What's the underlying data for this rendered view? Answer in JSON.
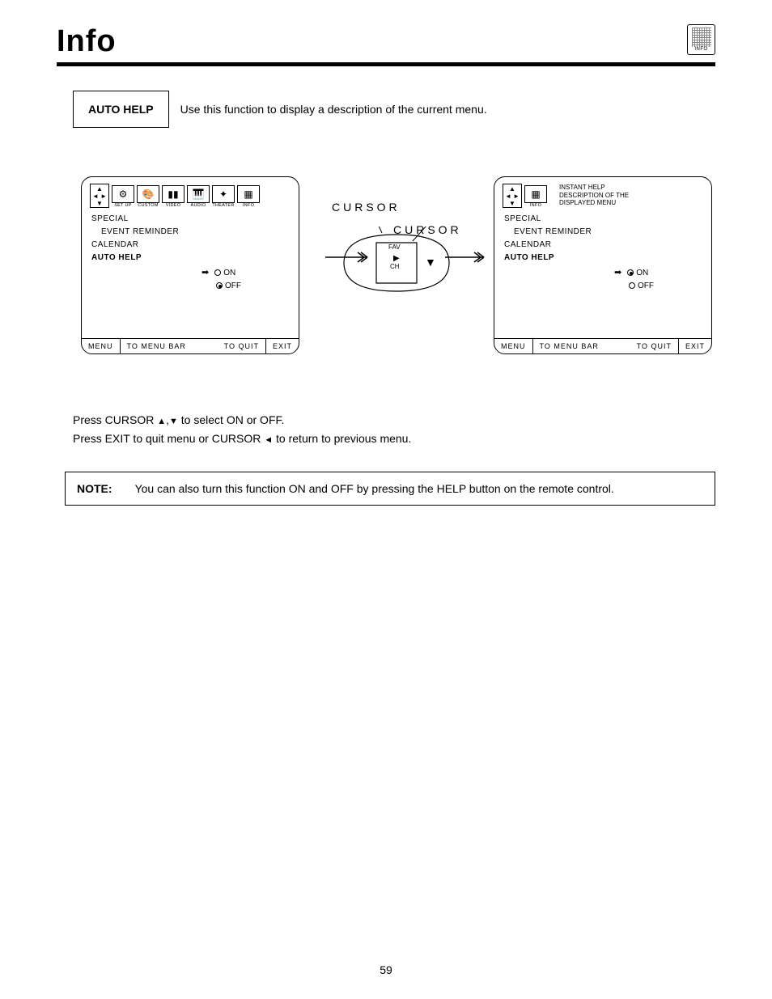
{
  "header": {
    "title": "Info",
    "corner_label": "INFO"
  },
  "intro": {
    "box_label": "AUTO HELP",
    "text": "Use this function to display a description of the current menu."
  },
  "screen_left": {
    "tabs": [
      {
        "label": "SET UP"
      },
      {
        "label": "CUSTOM"
      },
      {
        "label": "VIDEO"
      },
      {
        "label": "AUDIO"
      },
      {
        "label": "THEATER"
      },
      {
        "label": "INFO"
      }
    ],
    "items": {
      "special": "SPECIAL",
      "event_reminder": "EVENT REMINDER",
      "calendar": "CALENDAR",
      "auto_help": "AUTO HELP"
    },
    "options": {
      "on": "ON",
      "off": "OFF"
    },
    "footer": {
      "menu": "MENU",
      "to_menu_bar": "TO MENU BAR",
      "to_quit": "TO QUIT",
      "exit": "EXIT"
    }
  },
  "cursor": {
    "label1": "CURSOR",
    "label2": "CURSOR",
    "fav": "FAV",
    "ch": "CH"
  },
  "screen_right": {
    "tab_label": "INFO",
    "help_line1": "INSTANT HELP",
    "help_line2": "DESCRIPTION OF THE",
    "help_line3": "DISPLAYED MENU",
    "items": {
      "special": "SPECIAL",
      "event_reminder": "EVENT REMINDER",
      "calendar": "CALENDAR",
      "auto_help": "AUTO HELP"
    },
    "options": {
      "on": "ON",
      "off": "OFF"
    },
    "footer": {
      "menu": "MENU",
      "to_menu_bar": "TO MENU BAR",
      "to_quit": "TO QUIT",
      "exit": "EXIT"
    }
  },
  "instructions": {
    "line1a": "Press CURSOR ",
    "line1b": " to select ON or OFF.",
    "line2a": "Press EXIT to quit menu or CURSOR ",
    "line2b": " to return to previous menu."
  },
  "note": {
    "label": "NOTE:",
    "text": "You can also turn this function ON and OFF by pressing the HELP button on the remote control."
  },
  "page_number": "59"
}
